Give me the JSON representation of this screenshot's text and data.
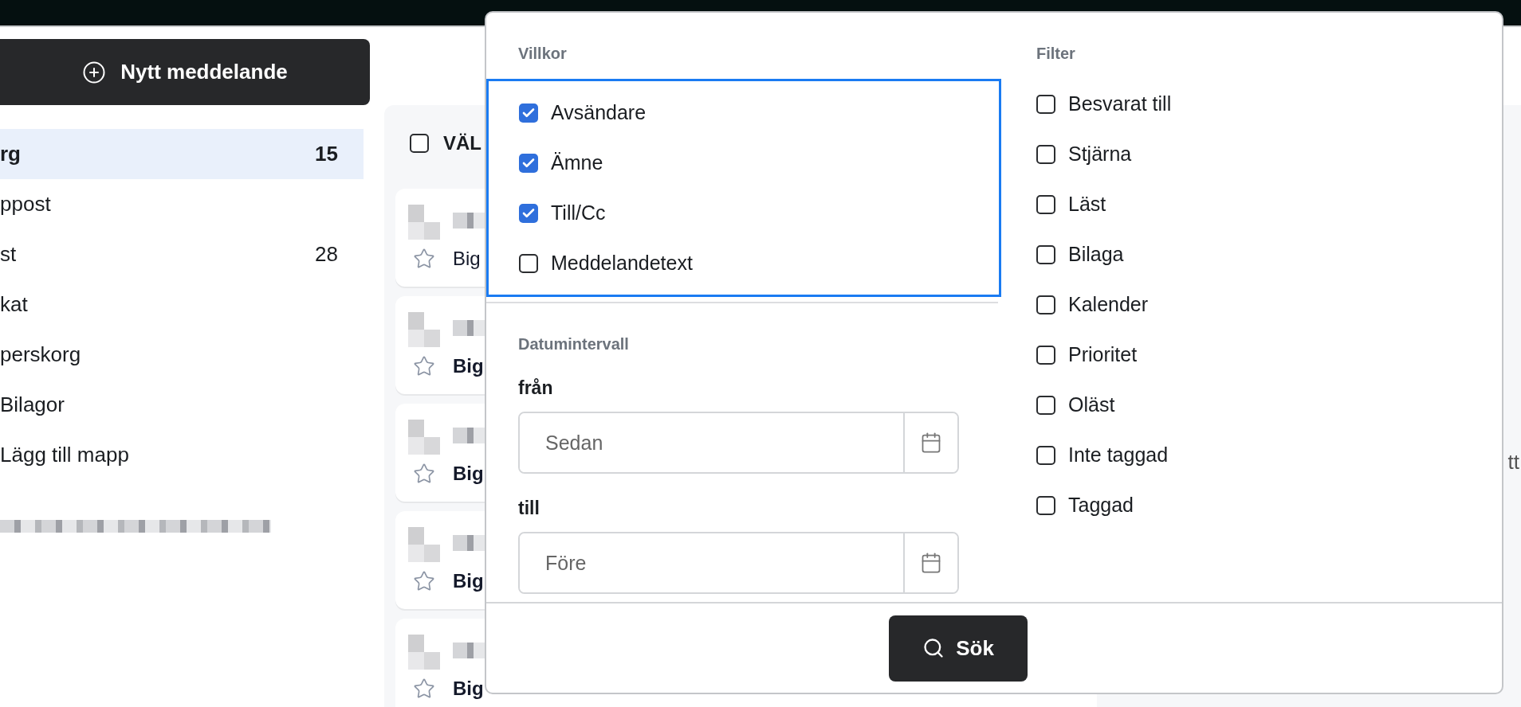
{
  "compose_button": {
    "label": "Nytt meddelande"
  },
  "folders": [
    {
      "label": "rg",
      "count": "15",
      "selected": true
    },
    {
      "label": "ppost",
      "selected": false
    },
    {
      "label": "st",
      "count": "28",
      "selected": false
    },
    {
      "label": "kat",
      "selected": false
    },
    {
      "label": "perskorg",
      "selected": false
    },
    {
      "label": "Bilagor",
      "selected": false
    },
    {
      "label": "Lägg till mapp",
      "selected": false
    }
  ],
  "message_list": {
    "header": {
      "label": "VÄL",
      "checked": false
    },
    "messages": [
      {
        "subject": "Big",
        "unread": false,
        "starred": false
      },
      {
        "subject": "Big",
        "unread": true,
        "starred": false
      },
      {
        "subject": "Big",
        "unread": true,
        "starred": false
      },
      {
        "subject": "Big",
        "unread": true,
        "starred": false
      },
      {
        "subject": "Big",
        "unread": true,
        "starred": false
      }
    ]
  },
  "reading_pane": {
    "text": "tt"
  },
  "search_popup": {
    "conditions": {
      "title": "Villkor",
      "options": [
        {
          "label": "Avsändare",
          "checked": true
        },
        {
          "label": "Ämne",
          "checked": true
        },
        {
          "label": "Till/Cc",
          "checked": true
        },
        {
          "label": "Meddelandetext",
          "checked": false
        }
      ]
    },
    "date_range": {
      "title": "Datumintervall",
      "from": {
        "label": "från",
        "placeholder": "Sedan"
      },
      "to": {
        "label": "till",
        "placeholder": "Före"
      }
    },
    "filters": {
      "title": "Filter",
      "options": [
        {
          "label": "Besvarat till",
          "checked": false
        },
        {
          "label": "Stjärna",
          "checked": false
        },
        {
          "label": "Läst",
          "checked": false
        },
        {
          "label": "Bilaga",
          "checked": false
        },
        {
          "label": "Kalender",
          "checked": false
        },
        {
          "label": "Prioritet",
          "checked": false
        },
        {
          "label": "Oläst",
          "checked": false
        },
        {
          "label": "Inte taggad",
          "checked": false
        },
        {
          "label": "Taggad",
          "checked": false
        }
      ]
    },
    "search_button": {
      "label": "Sök"
    }
  }
}
